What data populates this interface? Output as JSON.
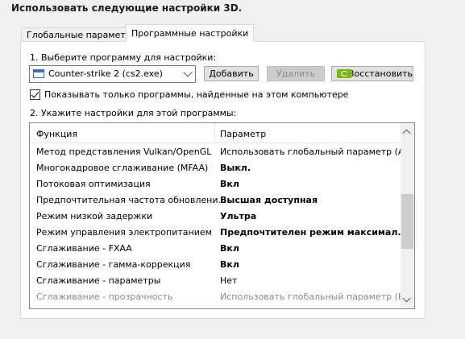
{
  "heading": "Использовать следующие настройки 3D.",
  "tabs": [
    {
      "label": "Глобальные параметры"
    },
    {
      "label": "Программные настройки"
    }
  ],
  "step1_label": "1. Выберите программу для настройки:",
  "program_select": {
    "value": "Counter-strike 2 (cs2.exe)"
  },
  "buttons": {
    "add": "Добавить",
    "remove": "Удалить",
    "restore": "Восстановить"
  },
  "checkbox": {
    "label": "Показывать только программы, найденные на этом компьютере",
    "checked": true
  },
  "step2_label": "2. Укажите настройки для этой программы:",
  "table": {
    "headers": [
      "Функция",
      "Параметр"
    ],
    "rows": [
      {
        "feature": "Метод представления Vulkan/OpenGL",
        "value": "Использовать глобальный параметр (А...",
        "style": "normal"
      },
      {
        "feature": "Многокадровое сглаживание (MFAA)",
        "value": "Выкл.",
        "style": "bold"
      },
      {
        "feature": "Потоковая оптимизация",
        "value": "Вкл",
        "style": "bold"
      },
      {
        "feature": "Предпочтительная частота обновлени...",
        "value": "Высшая доступная",
        "style": "bold"
      },
      {
        "feature": "Режим низкой задержки",
        "value": "Ультра",
        "style": "bold"
      },
      {
        "feature": "Режим управления электропитанием",
        "value": "Предпочтителен режим максимал...",
        "style": "bold"
      },
      {
        "feature": "Сглаживание - FXAA",
        "value": "Вкл",
        "style": "bold"
      },
      {
        "feature": "Сглаживание - гамма-коррекция",
        "value": "Вкл",
        "style": "bold"
      },
      {
        "feature": "Сглаживание - параметры",
        "value": "Нет",
        "style": "normal"
      },
      {
        "feature": "Сглаживание - прозрачность",
        "value": "Использовать глобальный параметр (В...",
        "style": "dim"
      }
    ]
  }
}
